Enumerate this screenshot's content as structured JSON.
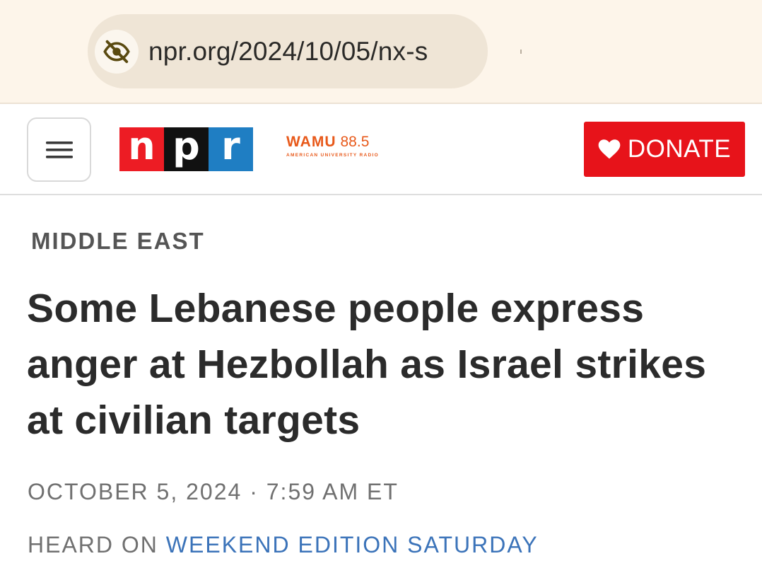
{
  "browser": {
    "url": "npr.org/2024/10/05/nx-s",
    "privacy_icon": "eye-off-icon"
  },
  "header": {
    "menu_icon": "hamburger-icon",
    "logo_letters": [
      "n",
      "p",
      "r"
    ],
    "station_name": "WAMU",
    "station_frequency": "88.5",
    "station_tagline": "AMERICAN UNIVERSITY RADIO",
    "donate_label": "DONATE",
    "donate_icon": "heart-icon"
  },
  "article": {
    "section": "MIDDLE EAST",
    "headline": "Some Lebanese people express anger at Hezbollah as Israel strikes at civilian targets",
    "dateline": "OCTOBER 5, 2024 · 7:59 AM ET",
    "heard_on_prefix": "HEARD ON",
    "program": "WEEKEND EDITION SATURDAY"
  },
  "colors": {
    "browser_bar": "#fdf5ea",
    "npr_red": "#ed1c24",
    "npr_black": "#111111",
    "npr_blue": "#1f7ec3",
    "wamu_orange": "#e8591a",
    "donate_red": "#e7131a",
    "link_blue": "#3b73b9"
  }
}
